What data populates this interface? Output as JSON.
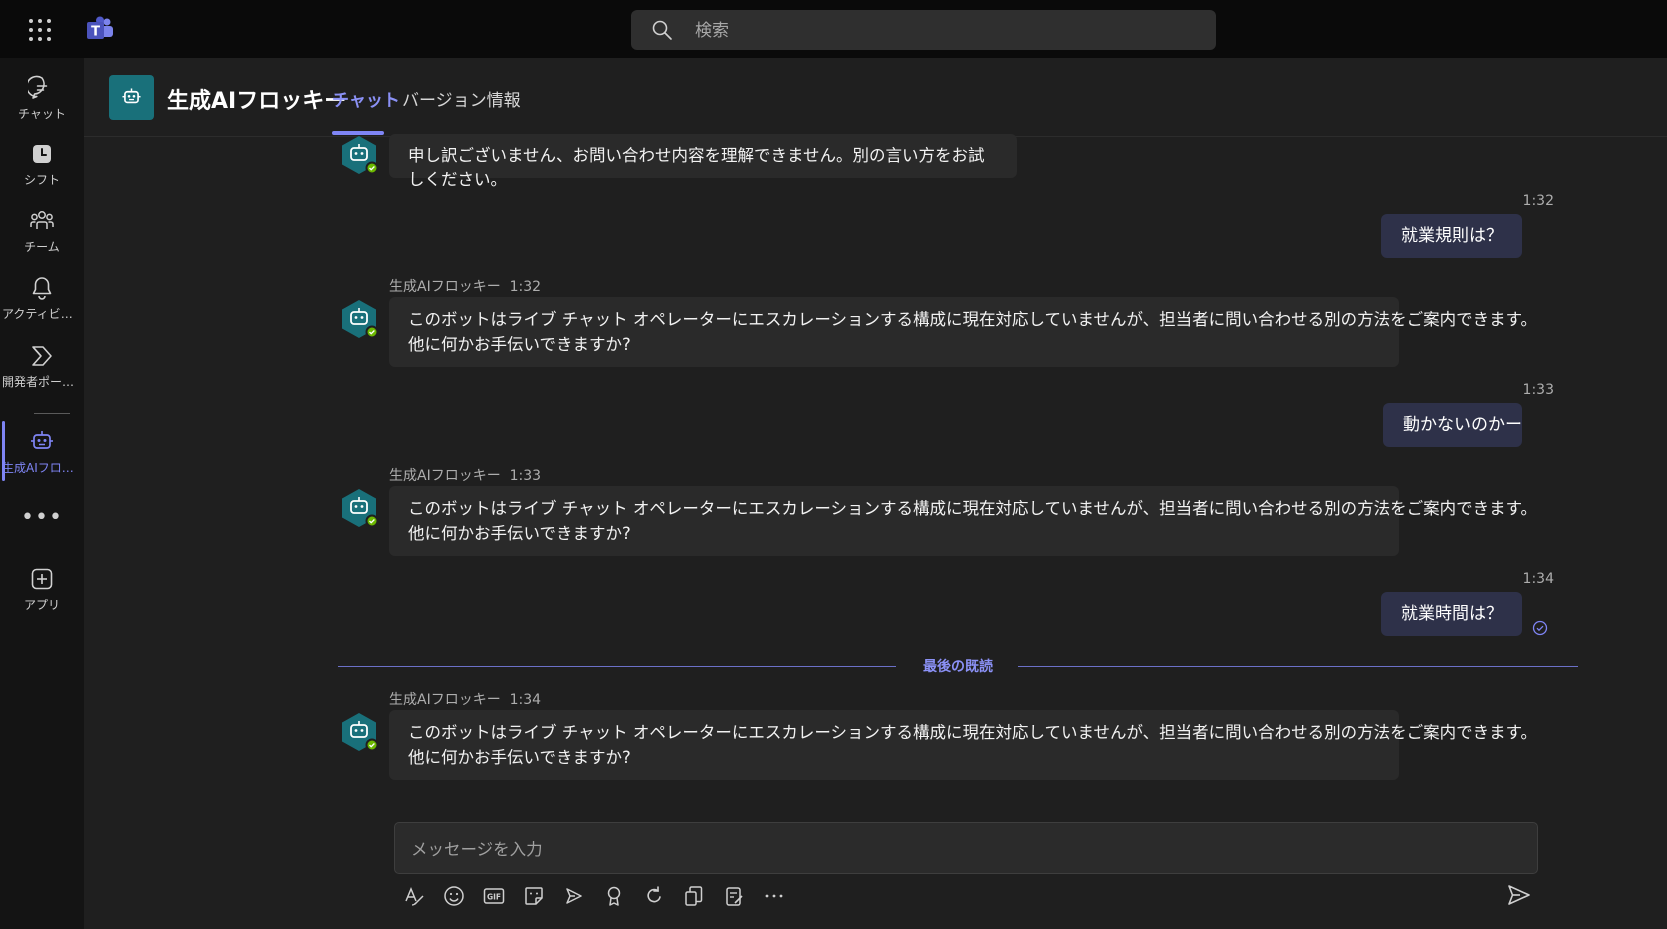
{
  "search": {
    "placeholder": "検索"
  },
  "rail": {
    "items": [
      {
        "label": "チャット",
        "icon": "chat-icon"
      },
      {
        "label": "シフト",
        "icon": "clock-icon"
      },
      {
        "label": "チーム",
        "icon": "teams-people-icon"
      },
      {
        "label": "アクティビティ",
        "icon": "bell-icon"
      },
      {
        "label": "開発者ポータ...",
        "icon": "developer-portal-icon"
      },
      {
        "label": "生成AIフロッ...",
        "icon": "bot-icon",
        "active": true
      },
      {
        "label": "アプリ",
        "icon": "add-app-icon"
      }
    ],
    "more": "•••"
  },
  "header": {
    "title": "生成AIフロッキー",
    "tabs": [
      {
        "label": "チャット",
        "active": true
      },
      {
        "label": "バージョン情報",
        "active": false
      }
    ]
  },
  "messages": {
    "m0": {
      "text": "申し訳ございません、お問い合わせ内容を理解できません。別の言い方をお試しください。"
    },
    "u1": {
      "time": "1:32",
      "text": "就業規則は？"
    },
    "b1": {
      "sender": "生成AIフロッキー",
      "time": "1:32",
      "line1": "このボットはライブ チャット オペレーターにエスカレーションする構成に現在対応していませんが、担当者に問い合わせる別の方法をご案内できます。",
      "line2": "他に何かお手伝いできますか?"
    },
    "u2": {
      "time": "1:33",
      "text": "動かないのかー"
    },
    "b2": {
      "sender": "生成AIフロッキー",
      "time": "1:33",
      "line1": "このボットはライブ チャット オペレーターにエスカレーションする構成に現在対応していませんが、担当者に問い合わせる別の方法をご案内できます。",
      "line2": "他に何かお手伝いできますか?"
    },
    "u3": {
      "time": "1:34",
      "text": "就業時間は？"
    },
    "b3": {
      "sender": "生成AIフロッキー",
      "time": "1:34",
      "line1": "このボットはライブ チャット オペレーターにエスカレーションする構成に現在対応していませんが、担当者に問い合わせる別の方法をご案内できます。",
      "line2": "他に何かお手伝いできますか?"
    }
  },
  "last_read": "最後の既読",
  "composer": {
    "placeholder": "メッセージを入力"
  },
  "colors": {
    "accent": "#7f85f5",
    "bot_avatar": "#19707a",
    "presence": "#6bb700",
    "user_bubble": "#2e3149"
  }
}
